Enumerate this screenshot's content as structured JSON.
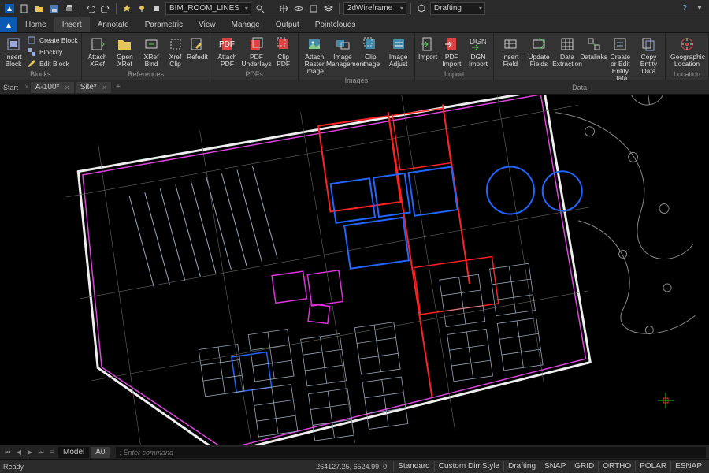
{
  "qat": {
    "filename": "BIM_ROOM_LINES",
    "view_tip": "▾",
    "visual_style": "2dWireframe",
    "workspace": "Drafting",
    "help": "?"
  },
  "menu": {
    "tabs": [
      "Home",
      "Insert",
      "Annotate",
      "Parametric",
      "View",
      "Manage",
      "Output",
      "Pointclouds"
    ],
    "active": 1
  },
  "ribbon": {
    "panels": [
      {
        "title": "Blocks",
        "big": [
          {
            "l": "Insert\nBlock",
            "i": "block"
          }
        ],
        "stack": [
          {
            "l": "Create Block",
            "i": "cube"
          },
          {
            "l": "Blockify",
            "i": "cube2"
          },
          {
            "l": "Edit Block",
            "i": "pencil"
          }
        ]
      },
      {
        "title": "References",
        "big": [
          {
            "l": "Attach\nXRef",
            "i": "attach"
          },
          {
            "l": "Open\nXRef",
            "i": "open"
          },
          {
            "l": "XRef\nBind",
            "i": "bind"
          },
          {
            "l": "Xref\nClip",
            "i": "clip"
          },
          {
            "l": "Refedit",
            "i": "edit"
          }
        ]
      },
      {
        "title": "PDFs",
        "big": [
          {
            "l": "Attach\nPDF",
            "i": "pdf"
          },
          {
            "l": "PDF\nUnderlays",
            "i": "pdfu"
          },
          {
            "l": "Clip\nPDF",
            "i": "pdfc"
          }
        ]
      },
      {
        "title": "Images",
        "big": [
          {
            "l": "Attach Raster\nImage",
            "i": "img"
          },
          {
            "l": "Image\nManagement",
            "i": "imgm"
          },
          {
            "l": "Clip\nImage",
            "i": "imgc"
          },
          {
            "l": "Image\nAdjust",
            "i": "imga"
          }
        ]
      },
      {
        "title": "Import",
        "big": [
          {
            "l": "Import",
            "i": "imp"
          },
          {
            "l": "PDF\nImport",
            "i": "pdfi"
          },
          {
            "l": "DGN\nImport",
            "i": "dgn"
          }
        ]
      },
      {
        "title": "Data",
        "big": [
          {
            "l": "Insert\nField",
            "i": "fld"
          },
          {
            "l": "Update\nFields",
            "i": "fldu"
          },
          {
            "l": "Data\nExtraction",
            "i": "dex"
          },
          {
            "l": "Datalinks",
            "i": "dl"
          },
          {
            "l": "Create or Edit\nEntity Data",
            "i": "ed"
          },
          {
            "l": "Copy Entity\nData",
            "i": "edc"
          }
        ]
      },
      {
        "title": "Location",
        "big": [
          {
            "l": "Geographic\nLocation",
            "i": "geo"
          }
        ]
      }
    ]
  },
  "doctabs": {
    "start": "Start",
    "tabs": [
      {
        "l": "A-100*"
      },
      {
        "l": "Site*"
      }
    ]
  },
  "layout": {
    "tabs": [
      "Model",
      "A0"
    ],
    "active": 0
  },
  "cmd": {
    "placeholder": ": Enter command"
  },
  "status": {
    "left": "Ready",
    "coords": "264127.25, 6524.99, 0",
    "buttons": [
      "Standard",
      "Custom DimStyle",
      "Drafting",
      "SNAP",
      "GRID",
      "ORTHO",
      "POLAR",
      "ESNAP"
    ]
  }
}
